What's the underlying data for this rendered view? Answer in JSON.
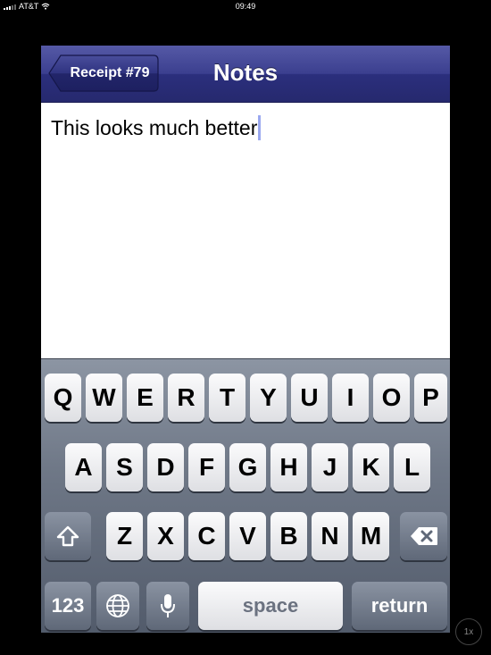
{
  "status_bar": {
    "carrier": "AT&T",
    "time": "09:49"
  },
  "navbar": {
    "back_label": "Receipt #79",
    "title": "Notes"
  },
  "notes": {
    "text": "This looks much better"
  },
  "keyboard": {
    "row1": [
      "Q",
      "W",
      "E",
      "R",
      "T",
      "Y",
      "U",
      "I",
      "O",
      "P"
    ],
    "row2": [
      "A",
      "S",
      "D",
      "F",
      "G",
      "H",
      "J",
      "K",
      "L"
    ],
    "row3": [
      "Z",
      "X",
      "C",
      "V",
      "B",
      "N",
      "M"
    ],
    "numbers_label": "123",
    "space_label": "space",
    "return_label": "return"
  },
  "zoom": {
    "label": "1x"
  },
  "colors": {
    "navbar_accent": "#3b3f8f",
    "caret": "#9aa8f0"
  }
}
